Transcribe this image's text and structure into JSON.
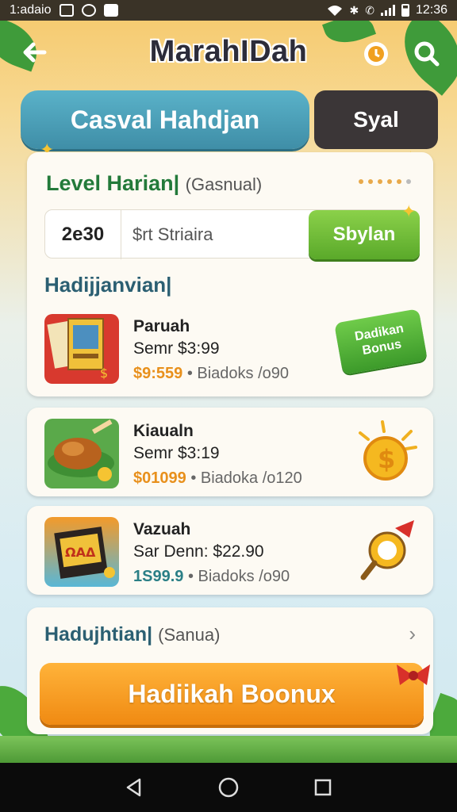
{
  "status_bar": {
    "carrier": "1:adaio",
    "time": "12:36"
  },
  "header": {
    "title": "MarahIDah",
    "back_icon": "back-arrow-icon",
    "timer_icon": "timer-icon",
    "search_icon": "search-icon"
  },
  "tabs": [
    {
      "label": "Casval Hahdjan"
    },
    {
      "label": "Syal"
    }
  ],
  "main_card": {
    "level_title": "Level Harian",
    "level_subtitle": "(Gasnual)",
    "score": "2e30",
    "search_placeholder": "$rt Striaira",
    "search_button": "Sbylan",
    "section_title": "Hadijjanvian",
    "bonus_badge": "Dadikan Bonus"
  },
  "items": [
    {
      "name": "Paruah",
      "price": "Semr $3:99",
      "value": "$9:559",
      "meta": "• Biadoks /o90",
      "value_color": "orange",
      "icon": "cards-pack-icon"
    },
    {
      "name": "Kiaualn",
      "price": "Semr $3:19",
      "value": "$01099",
      "meta": "• Biadoka /o120",
      "value_color": "orange",
      "icon": "roast-chicken-icon"
    },
    {
      "name": "Vazuah",
      "price": "Sar Denn: $22.90",
      "value": "1S99.9",
      "meta": "• Biadoks /o90",
      "value_color": "teal",
      "icon": "game-box-icon"
    }
  ],
  "footer_card": {
    "title": "Hadujhtian",
    "subtitle": "(Sanua)",
    "button": "Hadiikah Boonux"
  },
  "colors": {
    "accent_green": "#5aa92a",
    "accent_orange": "#f08a12",
    "accent_teal": "#3f8ea7"
  }
}
